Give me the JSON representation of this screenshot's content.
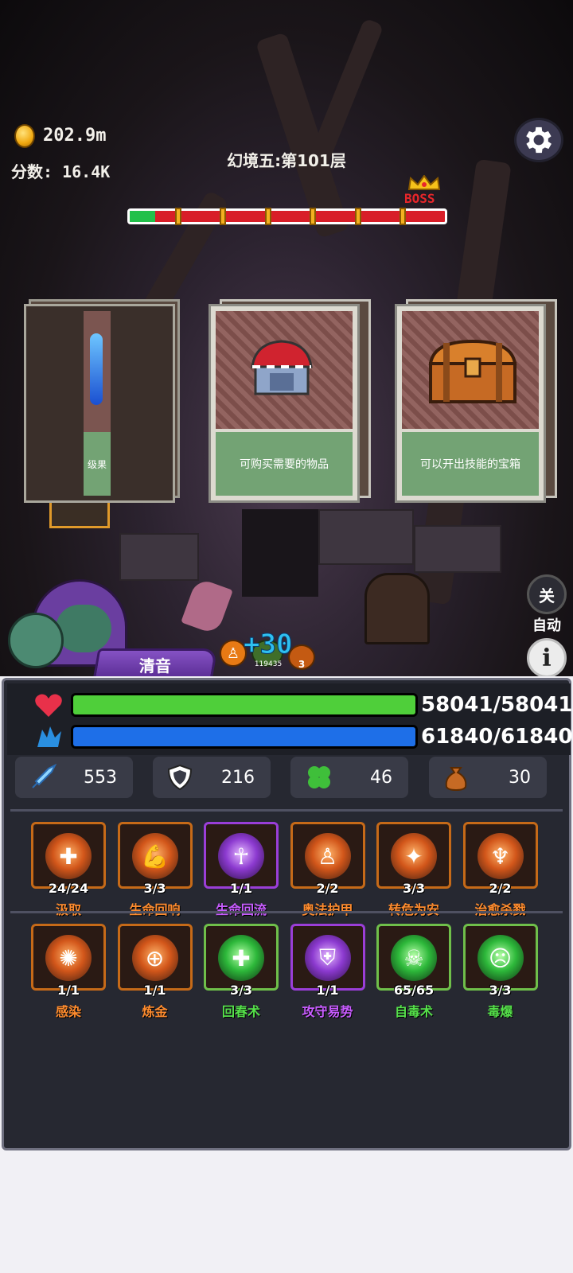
{
  "hud": {
    "coins": "202.9m",
    "score": "分数: 16.4K",
    "level_title": "幻境五:第101层",
    "boss_label": "BOSS",
    "stage_progress": 0.08,
    "stage_ticks": 6
  },
  "cards": [
    {
      "desc": "级果"
    },
    {
      "desc": "可购买需要的物品"
    },
    {
      "desc": "可以开出技能的宝箱"
    }
  ],
  "side_buttons": {
    "auto_toggle": "关",
    "auto_label": "自动",
    "info_icon": "i"
  },
  "hero": {
    "name": "清音",
    "buff_value": "119435",
    "buff_stack": "3",
    "gain_popup": "+30"
  },
  "vitals": {
    "hp_text": "58041/58041",
    "hp_fraction": 1.0,
    "mp_text": "61840/61840",
    "mp_fraction": 1.0,
    "hp_color": "#4fcf3a",
    "mp_color": "#1e6fe8"
  },
  "stats": [
    {
      "icon": "sword-icon",
      "value": "553"
    },
    {
      "icon": "shield-icon",
      "value": "216"
    },
    {
      "icon": "clover-icon",
      "value": "46"
    },
    {
      "icon": "money-bag-icon",
      "value": "30"
    }
  ],
  "skills_row1": [
    {
      "name": "汲取",
      "count": "24/24",
      "color": "orange",
      "glyph": "✚"
    },
    {
      "name": "生命回响",
      "count": "3/3",
      "color": "orange",
      "glyph": "💪"
    },
    {
      "name": "生命回流",
      "count": "1/1",
      "color": "purple",
      "glyph": "☥"
    },
    {
      "name": "奥法护甲",
      "count": "2/2",
      "color": "orange",
      "glyph": "♙"
    },
    {
      "name": "转危为安",
      "count": "3/3",
      "color": "orange",
      "glyph": "✦"
    },
    {
      "name": "治愈杀戮",
      "count": "2/2",
      "color": "orange",
      "glyph": "♆"
    }
  ],
  "skills_row2": [
    {
      "name": "感染",
      "count": "1/1",
      "color": "orange",
      "glyph": "✺"
    },
    {
      "name": "炼金",
      "count": "1/1",
      "color": "orange",
      "glyph": "⊕"
    },
    {
      "name": "回春术",
      "count": "3/3",
      "color": "green",
      "glyph": "✚"
    },
    {
      "name": "攻守易势",
      "count": "1/1",
      "color": "purple",
      "glyph": "⛨"
    },
    {
      "name": "自毒术",
      "count": "65/65",
      "color": "green",
      "glyph": "☠"
    },
    {
      "name": "毒爆",
      "count": "3/3",
      "color": "green",
      "glyph": "☹"
    }
  ]
}
